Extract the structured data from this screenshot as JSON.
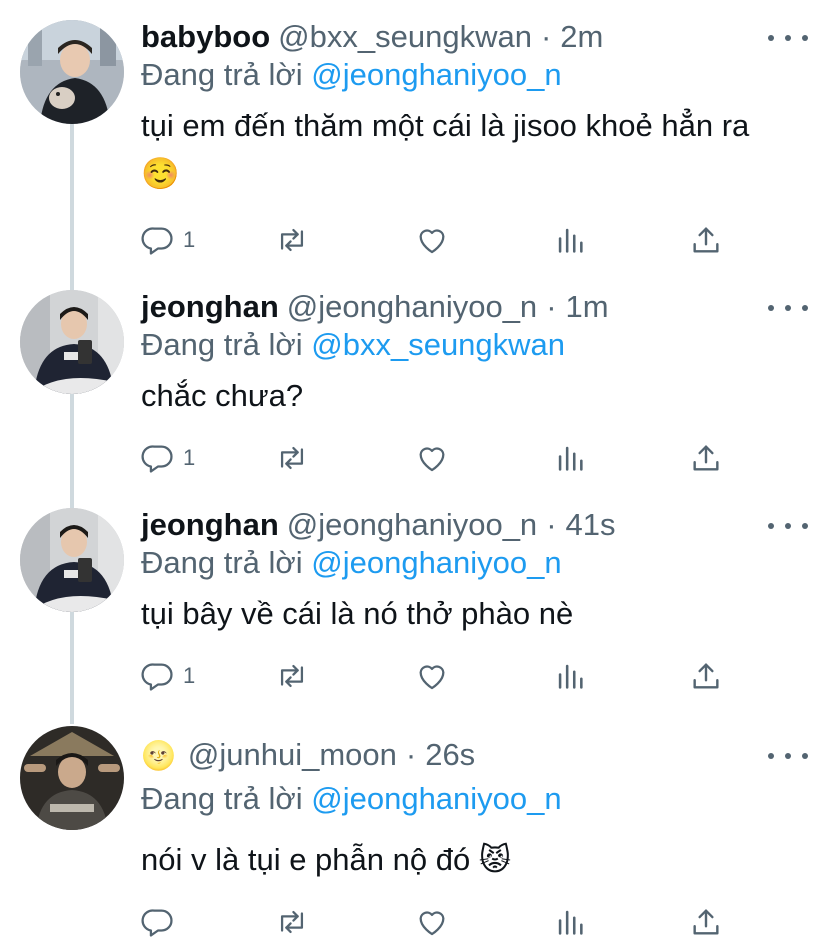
{
  "reply_prefix": "Đang trả lời",
  "tweets": [
    {
      "display_name": "babyboo",
      "handle": "@bxx_seungkwan",
      "separator": "·",
      "time": "2m",
      "reply_to": "@jeonghaniyoo_n",
      "text": "tụi em đến thăm một cái là jisoo khoẻ hẳn ra ☺️",
      "reply_count": "1",
      "avatar": "person-with-puppy"
    },
    {
      "display_name": "jeonghan",
      "handle": "@jeonghaniyoo_n",
      "separator": "·",
      "time": "1m",
      "reply_to": "@bxx_seungkwan",
      "text": "chắc chưa?",
      "reply_count": "1",
      "avatar": "person-mirror-selfie"
    },
    {
      "display_name": "jeonghan",
      "handle": "@jeonghaniyoo_n",
      "separator": "·",
      "time": "41s",
      "reply_to": "@jeonghaniyoo_n",
      "text": "tụi bây về cái là nó thở phào nè",
      "reply_count": "1",
      "avatar": "person-mirror-selfie"
    },
    {
      "display_name": "🌝",
      "handle": "@junhui_moon",
      "separator": "·",
      "time": "26s",
      "reply_to": "@jeonghaniyoo_n",
      "text": "nói v là tụi e phẫn nộ đó 😾",
      "reply_count": "",
      "avatar": "person-dark-portrait"
    }
  ],
  "icons": {
    "reply": "reply-icon",
    "retweet": "retweet-icon",
    "like": "heart-icon",
    "views": "analytics-icon",
    "share": "share-icon",
    "more": "more-icon"
  },
  "colors": {
    "text": "#0f1419",
    "secondary": "#536471",
    "mention": "#1d9bf0",
    "thread_line": "#cfd9de"
  }
}
